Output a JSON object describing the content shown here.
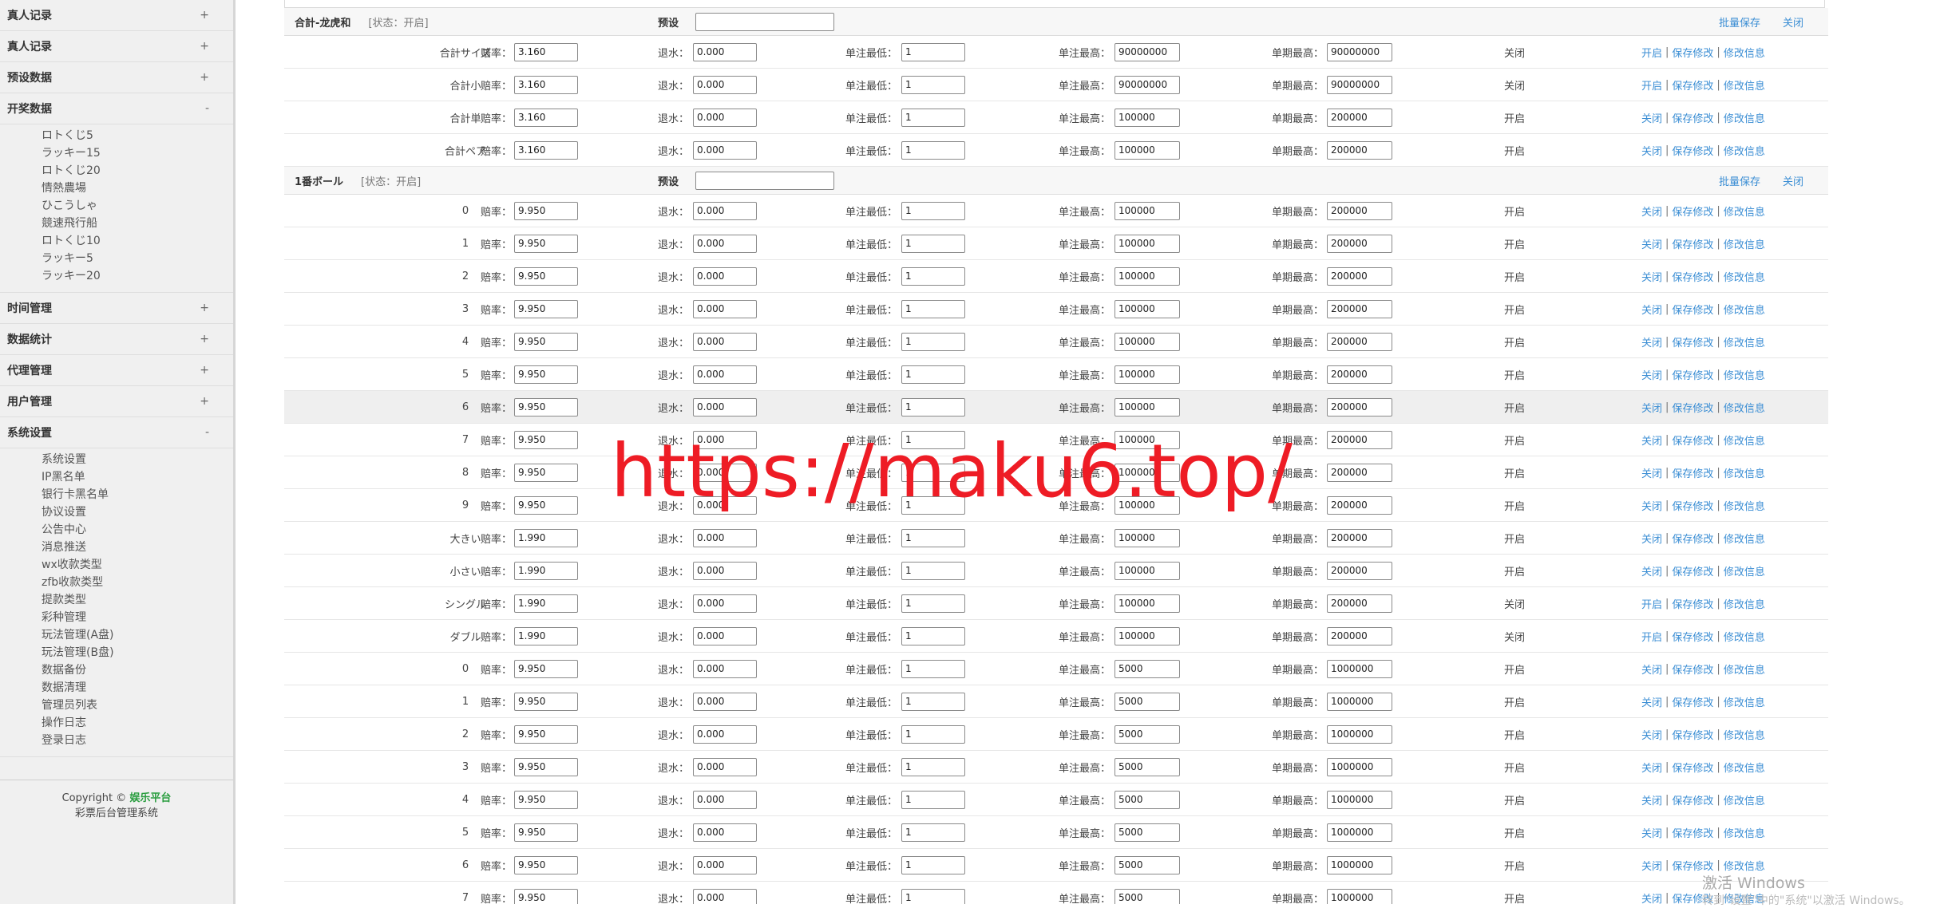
{
  "sidebar": {
    "groups": [
      {
        "title": "真人记录",
        "toggle": "+",
        "items": []
      },
      {
        "title": "真人记录",
        "toggle": "+",
        "items": []
      },
      {
        "title": "预设数据",
        "toggle": "+",
        "items": []
      },
      {
        "title": "开奖数据",
        "toggle": "-",
        "items": [
          "ロトくじ5",
          "ラッキー15",
          "ロトくじ20",
          "情熱農場",
          "ひこうしゃ",
          "競速飛行船",
          "ロトくじ10",
          "ラッキー5",
          "ラッキー20"
        ]
      },
      {
        "title": "时间管理",
        "toggle": "+",
        "items": []
      },
      {
        "title": "数据统计",
        "toggle": "+",
        "items": []
      },
      {
        "title": "代理管理",
        "toggle": "+",
        "items": []
      },
      {
        "title": "用户管理",
        "toggle": "+",
        "items": []
      },
      {
        "title": "系统设置",
        "toggle": "-",
        "items": [
          "系统设置",
          "IP黑名单",
          "银行卡黑名单",
          "协议设置",
          "公告中心",
          "消息推送",
          "wx收款类型",
          "zfb收款类型",
          "提款类型",
          "彩种管理",
          "玩法管理(A盘)",
          "玩法管理(B盘)",
          "数据备份",
          "数据清理",
          "管理员列表",
          "操作日志",
          "登录日志"
        ]
      }
    ]
  },
  "copyright": {
    "prefix": "Copyright © ",
    "brand": "娱乐平台",
    "subtitle": "彩票后台管理系统"
  },
  "labels": {
    "odds": "赔率：",
    "rebate": "退水：",
    "min_bet": "单注最低：",
    "max_bet": "单注最高：",
    "period_max": "单期最高：",
    "preset": "预设",
    "batch_save": "批量保存",
    "close": "关闭",
    "save_edit": "保存修改",
    "edit_info": "修改信息",
    "sep": "|"
  },
  "sections": [
    {
      "title": "合計-龙虎和",
      "state": "[状态：开启]",
      "rows": [
        {
          "name": "合計サイズ",
          "odds": "3.160",
          "rebate": "0.000",
          "min": "1",
          "max": "90000000",
          "period": "90000000",
          "status": "关闭",
          "toggle": "开启"
        },
        {
          "name": "合計小",
          "odds": "3.160",
          "rebate": "0.000",
          "min": "1",
          "max": "90000000",
          "period": "90000000",
          "status": "关闭",
          "toggle": "开启"
        },
        {
          "name": "合計単",
          "odds": "3.160",
          "rebate": "0.000",
          "min": "1",
          "max": "100000",
          "period": "200000",
          "status": "开启",
          "toggle": "关闭"
        },
        {
          "name": "合計ペア",
          "odds": "3.160",
          "rebate": "0.000",
          "min": "1",
          "max": "100000",
          "period": "200000",
          "status": "开启",
          "toggle": "关闭"
        }
      ]
    },
    {
      "title": "1番ボール",
      "state": "[状态：开启]",
      "rows": [
        {
          "name": "0",
          "odds": "9.950",
          "rebate": "0.000",
          "min": "1",
          "max": "100000",
          "period": "200000",
          "status": "开启",
          "toggle": "关闭"
        },
        {
          "name": "1",
          "odds": "9.950",
          "rebate": "0.000",
          "min": "1",
          "max": "100000",
          "period": "200000",
          "status": "开启",
          "toggle": "关闭"
        },
        {
          "name": "2",
          "odds": "9.950",
          "rebate": "0.000",
          "min": "1",
          "max": "100000",
          "period": "200000",
          "status": "开启",
          "toggle": "关闭"
        },
        {
          "name": "3",
          "odds": "9.950",
          "rebate": "0.000",
          "min": "1",
          "max": "100000",
          "period": "200000",
          "status": "开启",
          "toggle": "关闭"
        },
        {
          "name": "4",
          "odds": "9.950",
          "rebate": "0.000",
          "min": "1",
          "max": "100000",
          "period": "200000",
          "status": "开启",
          "toggle": "关闭"
        },
        {
          "name": "5",
          "odds": "9.950",
          "rebate": "0.000",
          "min": "1",
          "max": "100000",
          "period": "200000",
          "status": "开启",
          "toggle": "关闭"
        },
        {
          "name": "6",
          "odds": "9.950",
          "rebate": "0.000",
          "min": "1",
          "max": "100000",
          "period": "200000",
          "status": "开启",
          "toggle": "关闭"
        },
        {
          "name": "7",
          "odds": "9.950",
          "rebate": "0.000",
          "min": "1",
          "max": "100000",
          "period": "200000",
          "status": "开启",
          "toggle": "关闭"
        },
        {
          "name": "8",
          "odds": "9.950",
          "rebate": "0.000",
          "min": "1",
          "max": "100000",
          "period": "200000",
          "status": "开启",
          "toggle": "关闭"
        },
        {
          "name": "9",
          "odds": "9.950",
          "rebate": "0.000",
          "min": "1",
          "max": "100000",
          "period": "200000",
          "status": "开启",
          "toggle": "关闭"
        },
        {
          "name": "大きい",
          "odds": "1.990",
          "rebate": "0.000",
          "min": "1",
          "max": "100000",
          "period": "200000",
          "status": "开启",
          "toggle": "关闭"
        },
        {
          "name": "小さい",
          "odds": "1.990",
          "rebate": "0.000",
          "min": "1",
          "max": "100000",
          "period": "200000",
          "status": "开启",
          "toggle": "关闭"
        },
        {
          "name": "シングル",
          "odds": "1.990",
          "rebate": "0.000",
          "min": "1",
          "max": "100000",
          "period": "200000",
          "status": "关闭",
          "toggle": "开启"
        },
        {
          "name": "ダブル",
          "odds": "1.990",
          "rebate": "0.000",
          "min": "1",
          "max": "100000",
          "period": "200000",
          "status": "关闭",
          "toggle": "开启"
        },
        {
          "name": "0",
          "odds": "9.950",
          "rebate": "0.000",
          "min": "1",
          "max": "5000",
          "period": "1000000",
          "status": "开启",
          "toggle": "关闭"
        },
        {
          "name": "1",
          "odds": "9.950",
          "rebate": "0.000",
          "min": "1",
          "max": "5000",
          "period": "1000000",
          "status": "开启",
          "toggle": "关闭"
        },
        {
          "name": "2",
          "odds": "9.950",
          "rebate": "0.000",
          "min": "1",
          "max": "5000",
          "period": "1000000",
          "status": "开启",
          "toggle": "关闭"
        },
        {
          "name": "3",
          "odds": "9.950",
          "rebate": "0.000",
          "min": "1",
          "max": "5000",
          "period": "1000000",
          "status": "开启",
          "toggle": "关闭"
        },
        {
          "name": "4",
          "odds": "9.950",
          "rebate": "0.000",
          "min": "1",
          "max": "5000",
          "period": "1000000",
          "status": "开启",
          "toggle": "关闭"
        },
        {
          "name": "5",
          "odds": "9.950",
          "rebate": "0.000",
          "min": "1",
          "max": "5000",
          "period": "1000000",
          "status": "开启",
          "toggle": "关闭"
        },
        {
          "name": "6",
          "odds": "9.950",
          "rebate": "0.000",
          "min": "1",
          "max": "5000",
          "period": "1000000",
          "status": "开启",
          "toggle": "关闭"
        },
        {
          "name": "7",
          "odds": "9.950",
          "rebate": "0.000",
          "min": "1",
          "max": "5000",
          "period": "1000000",
          "status": "开启",
          "toggle": "关闭"
        }
      ]
    }
  ],
  "watermark": "https://maku6.top/",
  "windows_activation": {
    "title": "激活 Windows",
    "subtitle": "转到\"设置\"中的\"系统\"以激活 Windows。"
  },
  "colors": {
    "link": "#3b8ed4",
    "watermark": "#ee1c25",
    "brand": "#2a9d3f",
    "sidebar_bg": "#f0f0f0"
  }
}
